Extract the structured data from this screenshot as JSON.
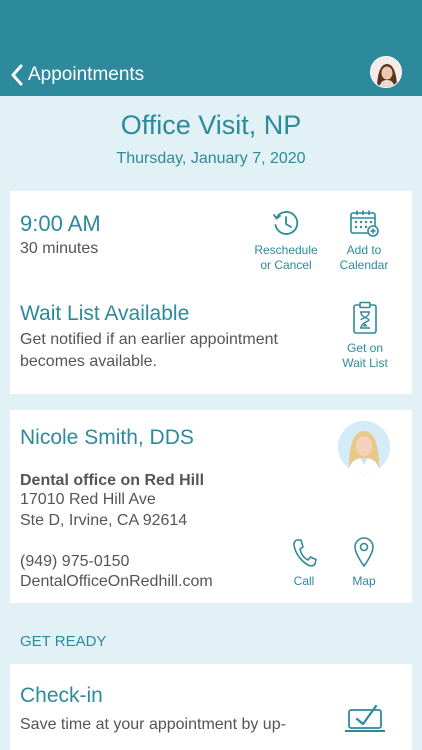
{
  "header": {
    "back_label": "Appointments"
  },
  "visit": {
    "title": "Office Visit, NP",
    "date": "Thursday, January 7, 2020"
  },
  "appointment": {
    "time": "9:00 AM",
    "duration": "30 minutes",
    "reschedule_label_line1": "Reschedule",
    "reschedule_label_line2": "or Cancel",
    "calendar_label_line1": "Add to",
    "calendar_label_line2": "Calendar"
  },
  "wait_list": {
    "title": "Wait List Available",
    "description": "Get notified if an earlier appointment becomes available.",
    "action_line1": "Get on",
    "action_line2": "Wait List"
  },
  "provider": {
    "name": "Nicole Smith, DDS",
    "office_name": "Dental office on Red Hill",
    "address_line1": "17010 Red Hill Ave",
    "address_line2": "Ste D, Irvine, CA 92614",
    "phone": "(949) 975-0150",
    "website": "DentalOfficeOnRedhill.com",
    "call_label": "Call",
    "map_label": "Map"
  },
  "get_ready": {
    "section_label": "GET READY",
    "checkin_title": "Check-in",
    "checkin_text": "Save time at your appointment by up-"
  },
  "colors": {
    "primary": "#2d8a9c",
    "background": "#e1f1f5",
    "text": "#555555"
  },
  "icons": [
    "chevron-left-icon",
    "clock-refresh-icon",
    "calendar-add-icon",
    "hourglass-clipboard-icon",
    "phone-icon",
    "map-pin-icon",
    "checkbox-icon"
  ]
}
